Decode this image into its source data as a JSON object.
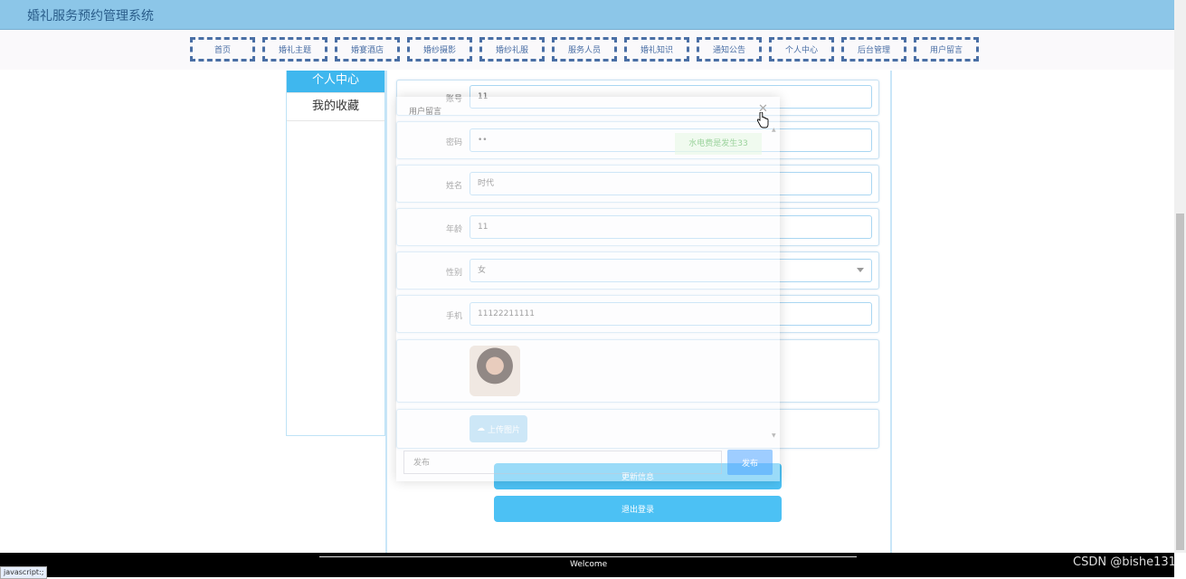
{
  "app": {
    "title": "婚礼服务预约管理系统"
  },
  "nav": [
    "首页",
    "婚礼主题",
    "婚宴酒店",
    "婚纱摄影",
    "婚纱礼服",
    "服务人员",
    "婚礼知识",
    "通知公告",
    "个人中心",
    "后台管理",
    "用户留言"
  ],
  "sidebar": {
    "items": [
      "个人中心",
      "我的收藏"
    ]
  },
  "form": {
    "account_label": "账号",
    "account_value": "11",
    "password_label": "密码",
    "password_value": "••",
    "name_label": "姓名",
    "name_value": "时代",
    "age_label": "年龄",
    "age_value": "11",
    "gender_label": "性别",
    "gender_value": "女",
    "phone_label": "手机",
    "phone_value": "11122211111",
    "upload_label": "上传图片",
    "update_button": "更新信息",
    "logout_button": "退出登录"
  },
  "dialog": {
    "title": "用户留言",
    "close": "✕",
    "message": "水电费是发生33",
    "input_placeholder": "发布",
    "send_button": "发布"
  },
  "footer": {
    "text": "Welcome"
  },
  "watermark": "CSDN @bishe131",
  "status_bar": "javascript:;",
  "colors": {
    "topbar": "#8cc6e8",
    "accent": "#4cc1f4",
    "nav_border": "#4a6fa5"
  }
}
